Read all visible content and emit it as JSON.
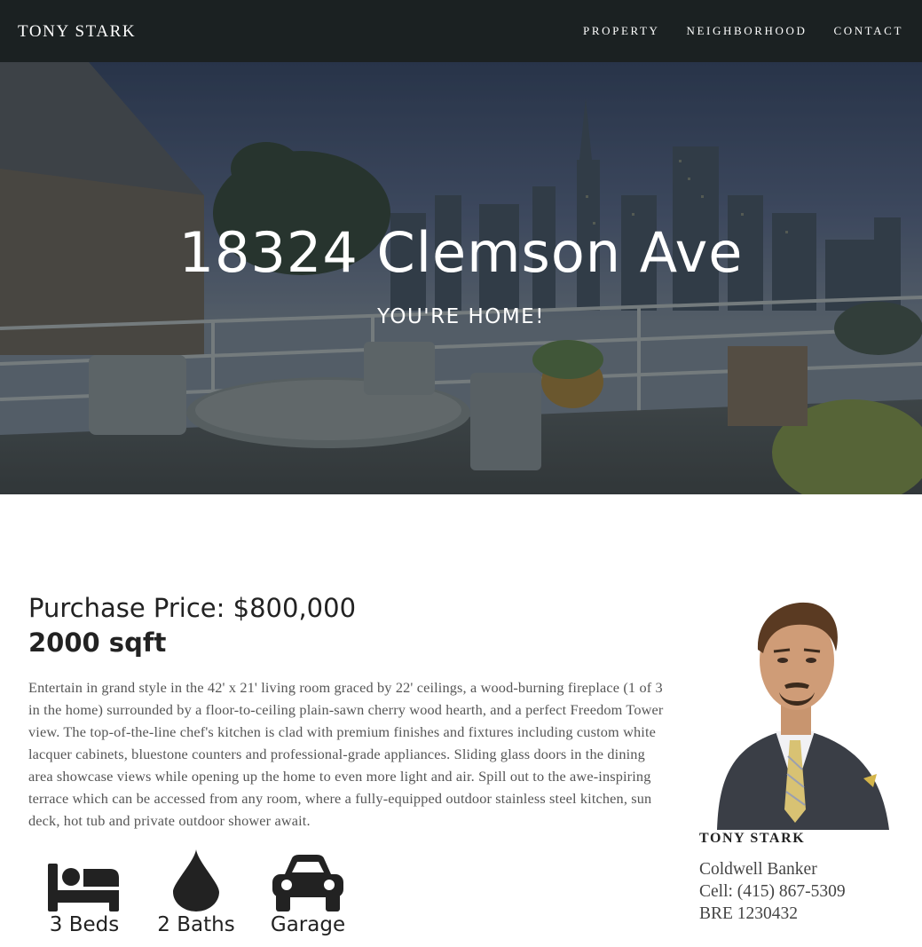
{
  "navbar": {
    "brand": "TONY STARK",
    "links": [
      "PROPERTY",
      "NEIGHBORHOOD",
      "CONTACT"
    ]
  },
  "hero": {
    "title": "18324 Clemson Ave",
    "subtitle": "YOU'RE HOME!"
  },
  "property": {
    "price": "Purchase Price: $800,000",
    "sqft": "2000 sqft",
    "description": "Entertain in grand style in the 42' x 21' living room graced by 22' ceilings, a wood-burning fireplace (1 of 3 in the home) surrounded by a floor-to-ceiling plain-sawn cherry wood hearth, and a perfect Freedom Tower view. The top-of-the-line chef's kitchen is clad with premium finishes and fixtures including custom white lacquer cabinets, bluestone counters and professional-grade appliances. Sliding glass doors in the dining area showcase views while opening up the home to even more light and air. Spill out to the awe-inspiring terrace which can be accessed from any room, where a fully-equipped outdoor stainless steel kitchen, sun deck, hot tub and private outdoor shower await.",
    "features": [
      {
        "label": "3 Beds",
        "icon": "bed-icon"
      },
      {
        "label": "2 Baths",
        "icon": "water-drop-icon"
      },
      {
        "label": "Garage",
        "icon": "car-icon"
      }
    ]
  },
  "agent": {
    "name": "TONY STARK",
    "company": "Coldwell Banker",
    "cell": "Cell: (415) 867-5309",
    "license": "BRE 1230432"
  },
  "colors": {
    "navbar_bg": "#1b2122",
    "text_dark": "#222222",
    "text_body": "#555555"
  }
}
